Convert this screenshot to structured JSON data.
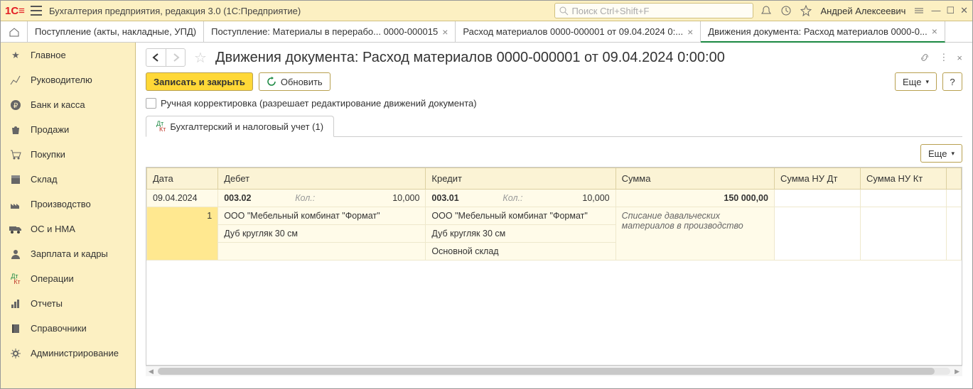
{
  "app": {
    "title": "Бухгалтерия предприятия, редакция 3.0  (1С:Предприятие)",
    "search_placeholder": "Поиск Ctrl+Shift+F",
    "user": "Андрей Алексеевич"
  },
  "tabs": [
    {
      "label": "Поступление (акты, накладные, УПД)",
      "closable": false
    },
    {
      "label": "Поступление: Материалы в перерабо... 0000-000015",
      "closable": true
    },
    {
      "label": "Расход материалов 0000-000001 от 09.04.2024 0:...",
      "closable": true
    },
    {
      "label": "Движения документа: Расход материалов 0000-0...",
      "closable": true,
      "active": true
    }
  ],
  "sidebar": [
    {
      "label": "Главное",
      "icon": "star"
    },
    {
      "label": "Руководителю",
      "icon": "chart"
    },
    {
      "label": "Банк и касса",
      "icon": "ruble"
    },
    {
      "label": "Продажи",
      "icon": "bag"
    },
    {
      "label": "Покупки",
      "icon": "cart"
    },
    {
      "label": "Склад",
      "icon": "pack"
    },
    {
      "label": "Производство",
      "icon": "factory"
    },
    {
      "label": "ОС и НМА",
      "icon": "truck"
    },
    {
      "label": "Зарплата и кадры",
      "icon": "person"
    },
    {
      "label": "Операции",
      "icon": "dtkt"
    },
    {
      "label": "Отчеты",
      "icon": "bars"
    },
    {
      "label": "Справочники",
      "icon": "book"
    },
    {
      "label": "Администрирование",
      "icon": "gear"
    }
  ],
  "page": {
    "title": "Движения документа: Расход материалов 0000-000001 от 09.04.2024 0:00:00",
    "save_close": "Записать и закрыть",
    "refresh": "Обновить",
    "more": "Еще",
    "manual_edit": "Ручная корректировка (разрешает редактирование движений документа)",
    "inner_tab": "Бухгалтерский и налоговый учет (1)",
    "table": {
      "headers": {
        "date": "Дата",
        "debit": "Дебет",
        "credit": "Кредит",
        "sum": "Сумма",
        "nud": "Сумма НУ Дт",
        "nuk": "Сумма НУ Кт"
      },
      "row": {
        "date": "09.04.2024",
        "num": "1",
        "debit_acc": "003.02",
        "debit_kol_lbl": "Кол.:",
        "debit_qty": "10,000",
        "debit_org": "ООО \"Мебельный комбинат \"Формат\"",
        "debit_item": "Дуб кругляк 30 см",
        "credit_acc": "003.01",
        "credit_kol_lbl": "Кол.:",
        "credit_qty": "10,000",
        "credit_org": "ООО \"Мебельный комбинат \"Формат\"",
        "credit_item": "Дуб кругляк 30 см",
        "credit_wh": "Основной склад",
        "sum": "150 000,00",
        "desc": "Списание давальческих материалов в производство"
      }
    }
  }
}
